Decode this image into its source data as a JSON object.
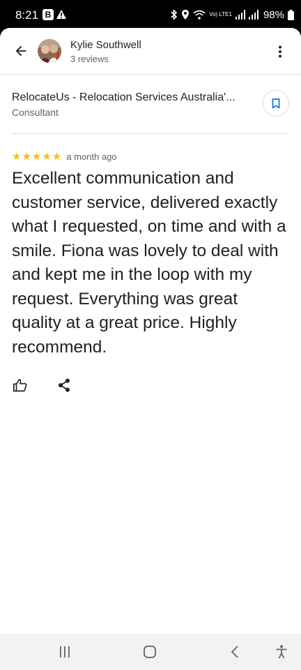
{
  "status_bar": {
    "time": "8:21",
    "b_badge": "B",
    "lte_label": "Vo) LTE1",
    "battery": "98%"
  },
  "header": {
    "user_name": "Kylie Southwell",
    "review_count": "3 reviews",
    "back_icon": "arrow-back-icon",
    "more_icon": "more-vert-icon"
  },
  "place": {
    "name": "RelocateUs - Relocation Services Australia'...",
    "category": "Consultant",
    "save_icon": "bookmark-icon"
  },
  "review": {
    "rating": 5,
    "date": "a month ago",
    "text": "Excellent communication and customer service, delivered exactly what I requested, on time and with a smile. Fiona was lovely to deal with and kept me in the loop with my request. Everything was great quality at a great price. Highly recommend.",
    "star_color": "#fbbc04"
  },
  "actions": {
    "like_icon": "thumb-up-icon",
    "share_icon": "share-icon"
  },
  "colors": {
    "accent": "#1a73e8",
    "text_primary": "#202124",
    "text_secondary": "#5f6368"
  }
}
